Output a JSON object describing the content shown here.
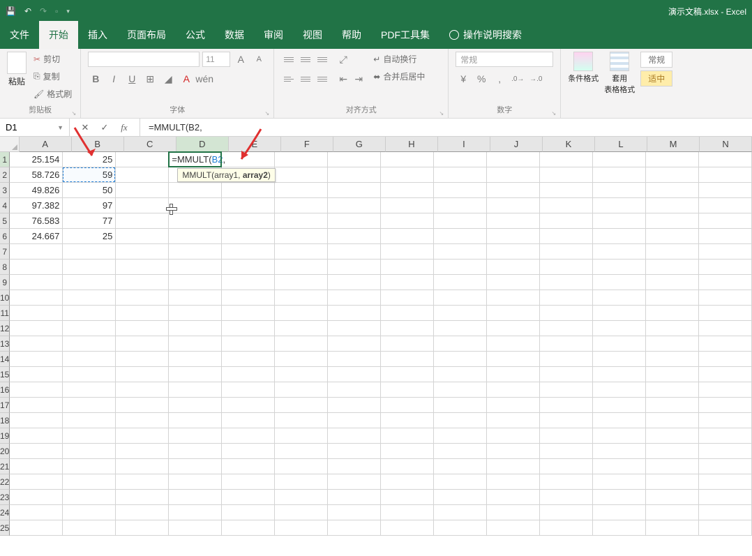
{
  "titlebar": {
    "title": "演示文稿.xlsx - Excel"
  },
  "menubar": {
    "tabs": [
      "文件",
      "开始",
      "插入",
      "页面布局",
      "公式",
      "数据",
      "审阅",
      "视图",
      "帮助",
      "PDF工具集"
    ],
    "tell_me": "操作说明搜索",
    "active_index": 1
  },
  "ribbon": {
    "clipboard": {
      "paste": "粘贴",
      "cut": "剪切",
      "copy": "复制",
      "format_painter": "格式刷",
      "label": "剪贴板"
    },
    "font": {
      "size": "11",
      "label": "字体"
    },
    "alignment": {
      "wrap": "自动换行",
      "merge_center": "合并后居中",
      "label": "对齐方式"
    },
    "number": {
      "format": "常规",
      "label": "数字"
    },
    "styles": {
      "cond_format": "条件格式",
      "table_format": "套用\n表格格式",
      "general": "常规",
      "neutral": "适中"
    }
  },
  "formula_bar": {
    "name_box": "D1",
    "formula": "=MMULT(B2,"
  },
  "grid": {
    "columns": [
      "A",
      "B",
      "C",
      "D",
      "E",
      "F",
      "G",
      "H",
      "I",
      "J",
      "K",
      "L",
      "M",
      "N"
    ],
    "rows": 25,
    "active_col_index": 3,
    "active_row_index": 0,
    "data": {
      "A": [
        "25.154",
        "58.726",
        "49.826",
        "97.382",
        "76.583",
        "24.667"
      ],
      "B": [
        "25",
        "59",
        "50",
        "97",
        "77",
        "25"
      ]
    },
    "editing_cell": {
      "prefix": "=",
      "fn": "MMULT",
      "open": "(",
      "ref": "B2",
      "suffix": ","
    },
    "tooltip": {
      "fn": "MMULT",
      "arg1": "array1",
      "arg2": "array2"
    },
    "ref_cell": {
      "col": 1,
      "row": 1
    }
  }
}
